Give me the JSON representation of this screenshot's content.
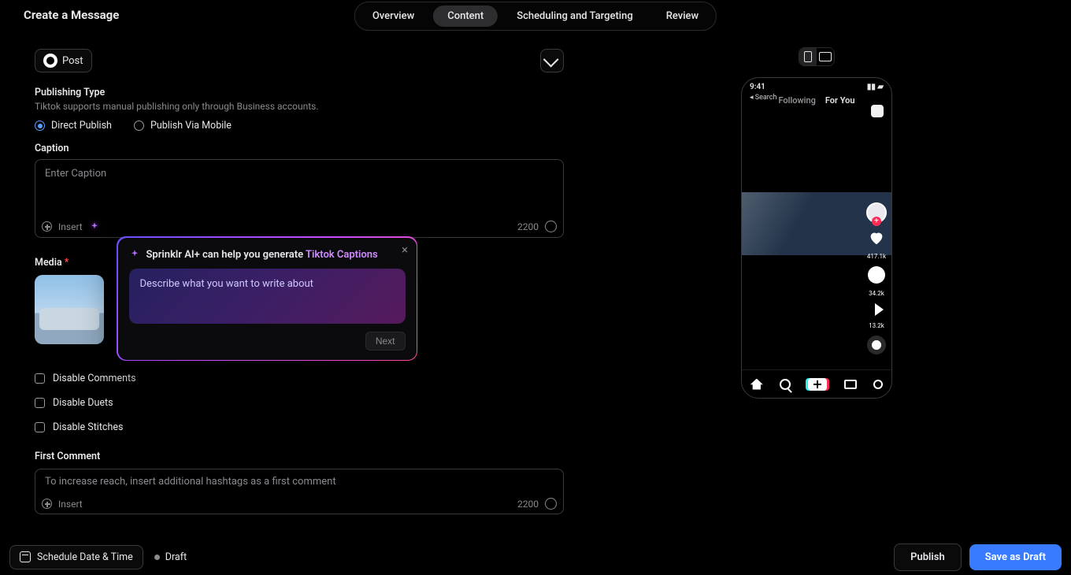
{
  "header": {
    "title": "Create a Message",
    "tabs": [
      "Overview",
      "Content",
      "Scheduling and Targeting",
      "Review"
    ],
    "active_tab": 1
  },
  "post_chip": {
    "icon": "tiktok-icon",
    "label": "Post",
    "edit_icon": "pencil-icon"
  },
  "publishing_type": {
    "title": "Publishing Type",
    "subtitle": "Tiktok supports manual publishing only through Business accounts.",
    "options": [
      "Direct Publish",
      "Publish Via Mobile"
    ],
    "selected": 0
  },
  "caption": {
    "label": "Caption",
    "placeholder": "Enter Caption",
    "insert_label": "Insert",
    "count": "2200",
    "sparkle_icon": "ai-sparkle-icon",
    "emoji_icon": "emoji-icon"
  },
  "ai": {
    "title_prefix": "Sprinklr AI+ can help you generate ",
    "title_accent": "Tiktok Captions",
    "placeholder": "Describe what you want to write about",
    "next_label": "Next",
    "close_icon": "close-icon"
  },
  "media": {
    "label": "Media",
    "required": "*"
  },
  "toggles": {
    "disable_comments": "Disable Comments",
    "disable_duets": "Disable Duets",
    "disable_stitches": "Disable Stitches"
  },
  "first_comment": {
    "label": "First Comment",
    "placeholder": "To increase reach, insert additional hashtags as a first comment",
    "insert_label": "Insert",
    "count": "2200"
  },
  "preview": {
    "device": "mobile",
    "phone": {
      "time": "9:41",
      "search": "◂ Search",
      "following": "Following",
      "for_you": "For You",
      "mute_icon": "mute-icon",
      "likes": "417.1k",
      "comments": "34.2k",
      "shares": "13.2k",
      "nav_icons": [
        "home-icon",
        "search-icon",
        "create-icon",
        "inbox-icon",
        "profile-icon"
      ]
    }
  },
  "footer": {
    "schedule_label": "Schedule Date & Time",
    "status": "Draft",
    "publish": "Publish",
    "save_draft": "Save as Draft"
  },
  "colors": {
    "accent": "#387bff"
  }
}
